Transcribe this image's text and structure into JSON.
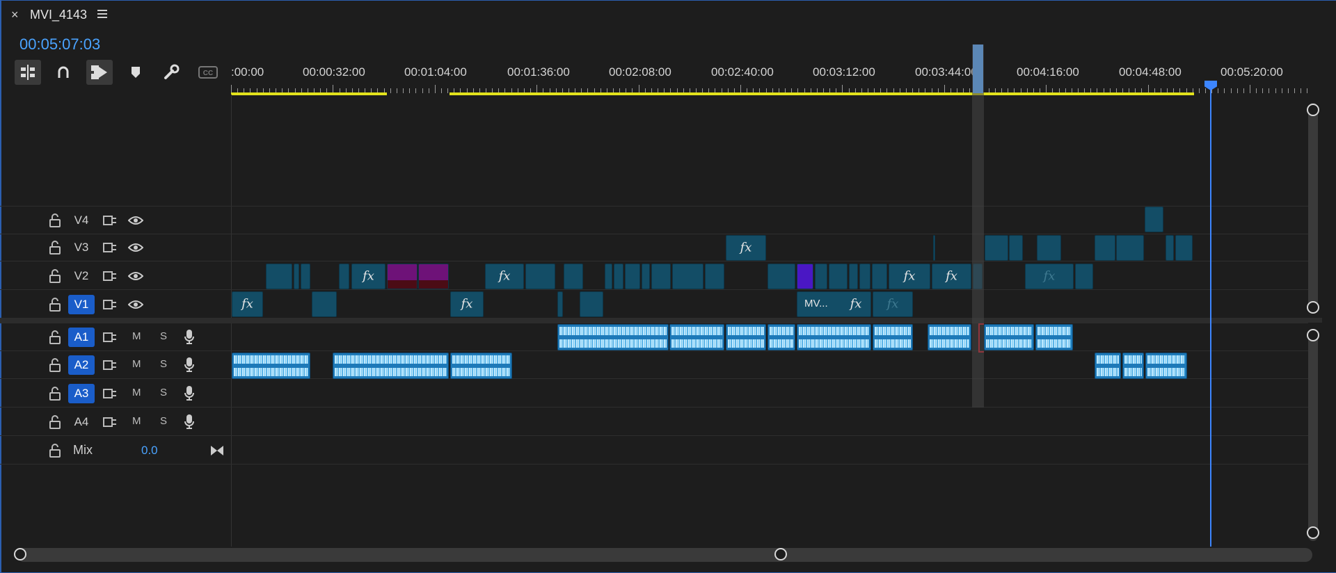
{
  "window": {
    "close": "×",
    "title": "MVI_4143",
    "timecode": "00:05:07:03"
  },
  "toolbar": [
    "insert-overwrite-icon",
    "snap-magnet-icon",
    "linked-selection-icon",
    "add-marker-icon",
    "settings-wrench-icon",
    "captions-icon"
  ],
  "ruler": {
    "labels": [
      ":00:00",
      "00:00:32:00",
      "00:01:04:00",
      "00:01:36:00",
      "00:02:08:00",
      "00:02:40:00",
      "00:03:12:00",
      "00:03:44:00",
      "00:04:16:00",
      "00:04:48:00",
      "00:05:20:00"
    ]
  },
  "tracks": {
    "video": [
      {
        "label": "V4",
        "targeted": false
      },
      {
        "label": "V3",
        "targeted": false
      },
      {
        "label": "V2",
        "targeted": false
      },
      {
        "label": "V1",
        "targeted": true
      }
    ],
    "audio": [
      {
        "label": "A1",
        "targeted": true,
        "m": "M",
        "s": "S"
      },
      {
        "label": "A2",
        "targeted": true,
        "m": "M",
        "s": "S"
      },
      {
        "label": "A3",
        "targeted": true,
        "m": "M",
        "s": "S"
      },
      {
        "label": "A4",
        "targeted": false,
        "m": "M",
        "s": "S"
      }
    ],
    "mix": {
      "label": "Mix",
      "value": "0.0"
    }
  },
  "clips": {
    "fx_label": "fx",
    "v1_clip_label": "MV..."
  },
  "colors": {
    "accent": "#4aa3ff",
    "video_clip": "#134d66",
    "audio_clip": "#1d79b8",
    "inout_bar": "#e2e21c",
    "cti": "#3d86ff"
  }
}
